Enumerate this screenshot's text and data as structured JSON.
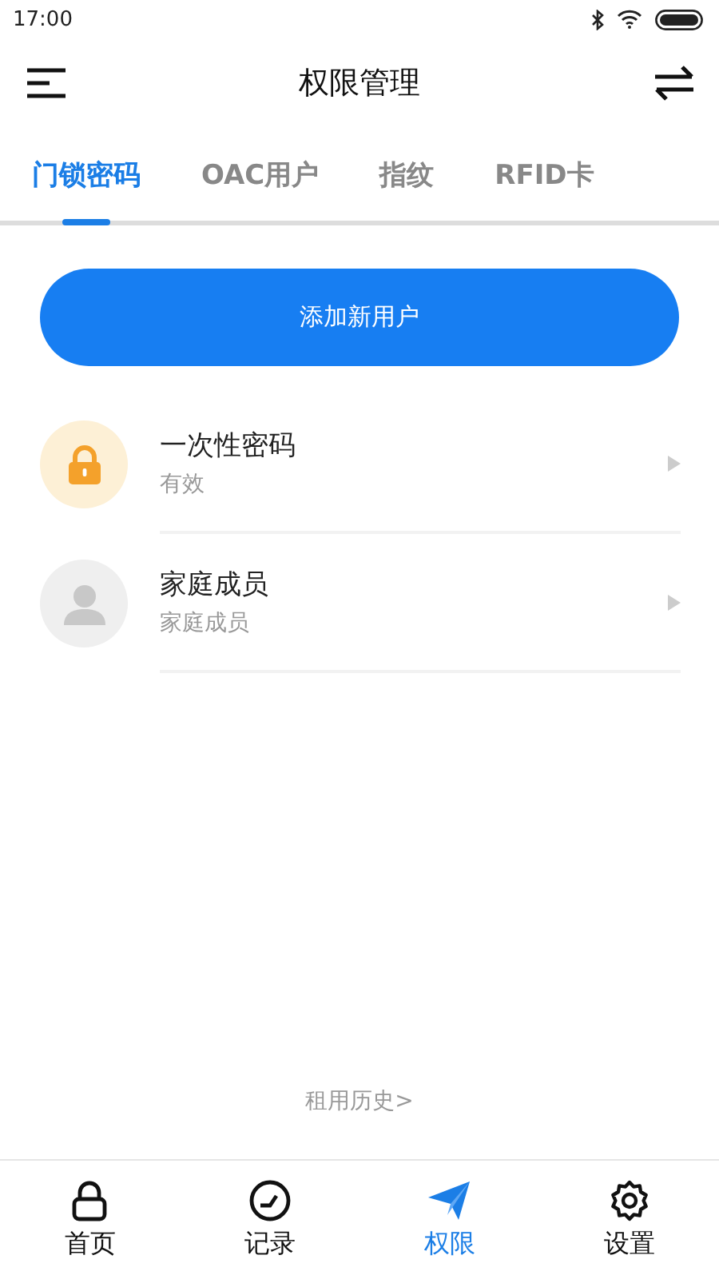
{
  "status_bar": {
    "time": "17:00"
  },
  "header": {
    "title": "权限管理"
  },
  "tabs": [
    {
      "label": "门锁密码",
      "selected": true
    },
    {
      "label": "OAC用户",
      "selected": false
    },
    {
      "label": "指纹",
      "selected": false
    },
    {
      "label": "RFID卡",
      "selected": false
    }
  ],
  "add_button": "添加新用户",
  "users": [
    {
      "kind": "lock",
      "name": "一次性密码",
      "status": "有效"
    },
    {
      "kind": "person",
      "name": "家庭成员",
      "status": "家庭成员"
    }
  ],
  "history_link": "租用历史>",
  "bottom_nav": [
    {
      "kind": "home",
      "label": "首页",
      "selected": false
    },
    {
      "kind": "records",
      "label": "记录",
      "selected": false
    },
    {
      "kind": "permissions",
      "label": "权限",
      "selected": true
    },
    {
      "kind": "settings",
      "label": "设置",
      "selected": false
    }
  ]
}
